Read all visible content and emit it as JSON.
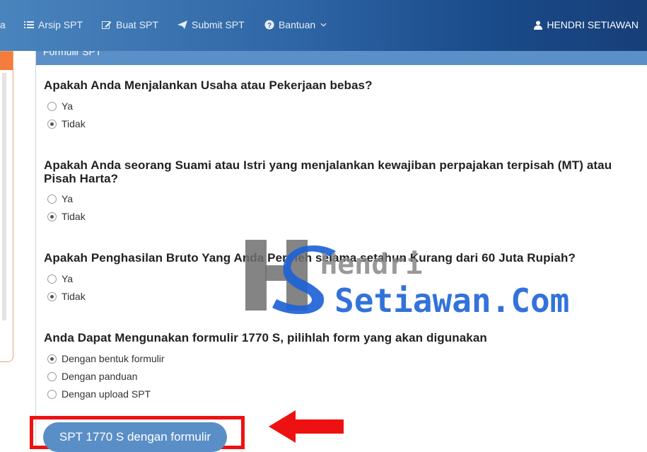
{
  "nav": {
    "partial_item": "a",
    "items": [
      {
        "label": "Arsip SPT",
        "icon": "list-icon"
      },
      {
        "label": "Buat SPT",
        "icon": "edit-icon"
      },
      {
        "label": "Submit SPT",
        "icon": "send-icon"
      },
      {
        "label": "Bantuan",
        "icon": "question-circle-icon"
      }
    ],
    "user_name": "HENDRI SETIAWAN"
  },
  "panel": {
    "title": "Formulir SPT"
  },
  "questions": [
    {
      "text": "Apakah Anda Menjalankan Usaha atau Pekerjaan bebas?",
      "options": [
        "Ya",
        "Tidak"
      ],
      "selected": "Tidak"
    },
    {
      "text": "Apakah Anda seorang Suami atau Istri yang menjalankan kewajiban perpajakan terpisah (MT) atau Pisah Harta?",
      "options": [
        "Ya",
        "Tidak"
      ],
      "selected": "Tidak"
    },
    {
      "text": "Apakah Penghasilan Bruto Yang Anda Peroleh selama setahun Kurang dari 60 Juta Rupiah?",
      "options": [
        "Ya",
        "Tidak"
      ],
      "selected": "Tidak"
    },
    {
      "text": "Anda Dapat Mengunakan formulir 1770 S, pilihlah form yang akan digunakan",
      "options": [
        "Dengan bentuk formulir",
        "Dengan panduan",
        "Dengan upload SPT"
      ],
      "selected": "Dengan bentuk formulir"
    }
  ],
  "submit_button": "SPT 1770 S dengan formulir",
  "watermark": {
    "line1": "Hendri",
    "line2": "Setiawan.Com"
  },
  "colors": {
    "nav_bg": "#2f66a6",
    "button_bg": "#5a8ec6",
    "highlight_box": "#ee1111",
    "left_panel_accent": "#f47c3c"
  }
}
